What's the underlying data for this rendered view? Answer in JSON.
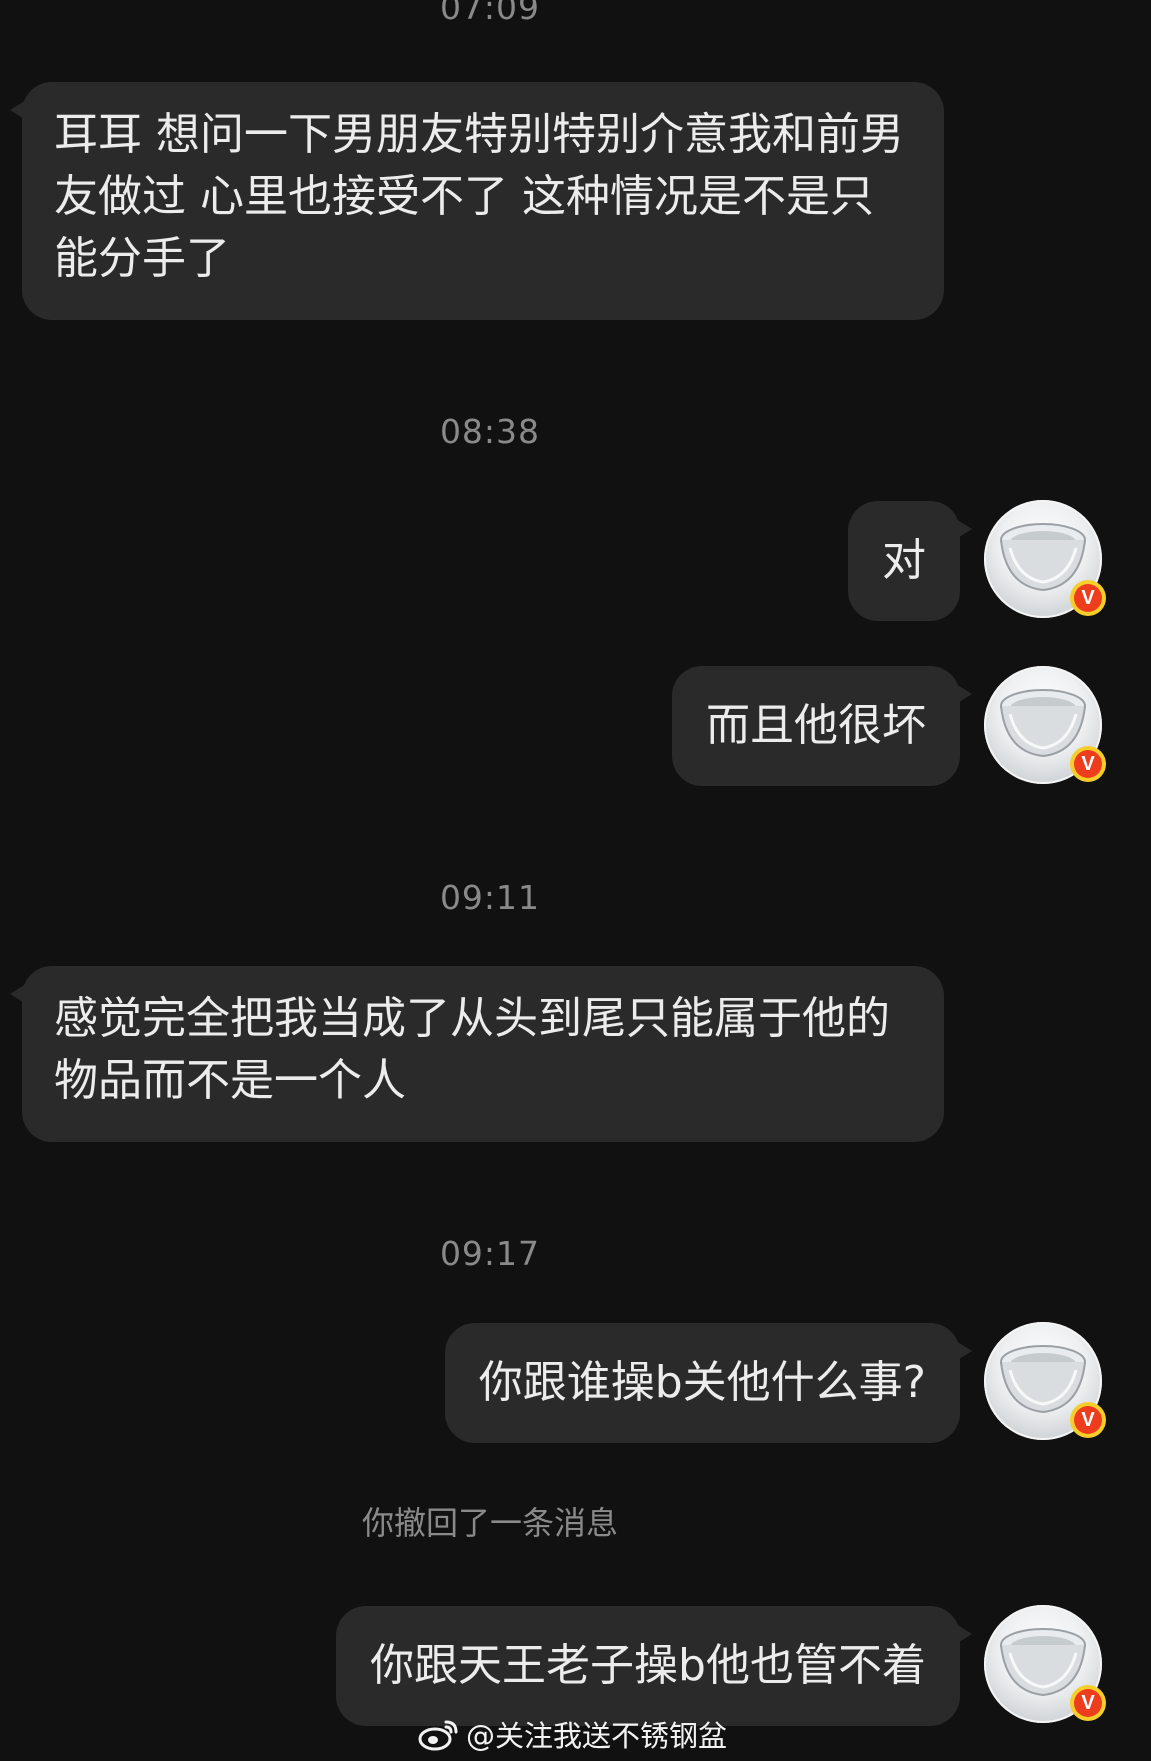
{
  "chat": {
    "timestamps": [
      "07:09",
      "08:38",
      "09:11",
      "09:17"
    ],
    "messages": {
      "m1": "耳耳 想问一下男朋友特别特别介意我和前男友做过  心里也接受不了  这种情况是不是只能分手了",
      "m2": "对",
      "m3": "而且他很坏",
      "m4": "感觉完全把我当成了从头到尾只能属于他的物品而不是一个人",
      "m5": "你跟谁操b关他什么事?",
      "m6": "你跟天王老子操b他也管不着"
    },
    "recalled_notice": "你撤回了一条消息",
    "verified_badge": "V"
  },
  "watermark": {
    "icon": "weibo-logo-icon",
    "text": "@关注我送不锈钢盆"
  },
  "colors": {
    "background": "#111111",
    "bubble": "#2a2a2a",
    "timestamp": "#8a8a8a",
    "badge_ring": "#f6ce2c",
    "badge_fill": "#ee3d1d"
  }
}
